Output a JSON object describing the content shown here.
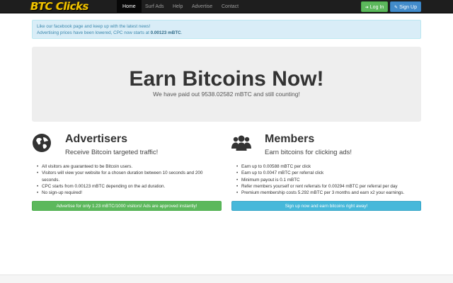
{
  "brand": {
    "logo_text": "BTC Clicks"
  },
  "nav": {
    "items": [
      {
        "label": "Home",
        "active": true
      },
      {
        "label": "Surf Ads",
        "active": false
      },
      {
        "label": "Help",
        "active": false
      },
      {
        "label": "Advertise",
        "active": false
      },
      {
        "label": "Contact",
        "active": false
      }
    ],
    "login_label": "Log In",
    "signup_label": "Sign Up",
    "login_icon": "login-icon",
    "signup_icon": "edit-icon"
  },
  "alert": {
    "line1": "Like our facebook page and keep up with the latest news!",
    "line2_prefix": "Advertising prices have been lowered, CPC now starts at ",
    "line2_value": "0.00123 mBTC",
    "line2_suffix": "."
  },
  "hero": {
    "title": "Earn Bitcoins Now!",
    "subtitle": "We have paid out 9538.02582 mBTC and still counting!"
  },
  "advertisers": {
    "icon": "globe-icon",
    "title": "Advertisers",
    "subtitle": "Receive Bitcoin targeted traffic!",
    "items": [
      "All visitors are guaranteed to be Bitcoin users.",
      "Visitors will view your website for a chosen duration between 10 seconds and 200 seconds.",
      "CPC starts from 0.00123 mBTC depending on the ad duration.",
      "No sign-up required!"
    ],
    "button_label": "Advertise for only 1.23 mBTC/1000 visitors! Ads are approved instantly!"
  },
  "members": {
    "icon": "users-icon",
    "title": "Members",
    "subtitle": "Earn bitcoins for clicking ads!",
    "items": [
      "Earn up to 0.00588 mBTC per click",
      "Earn up to 0.0047 mBTC per referral click",
      "Minimum payout is 0.1 mBTC",
      "Refer members yourself or rent referrals for 0.00294 mBTC per referral per day",
      "Premium membership costs 5.292 mBTC per 3 months and earn x2 your earnings."
    ],
    "button_label": "Sign up now and earn bitcoins right away!"
  },
  "colors": {
    "navbar": "#1e1e1e",
    "login": "#5cb85c",
    "signup": "#428bca",
    "alert_bg": "#d9edf7",
    "alert_text": "#3a87ad",
    "hero_bg": "#eeeeee",
    "advertise_button": "#5cb85c",
    "signup_button": "#46b8da",
    "logo": "#f2c400"
  }
}
